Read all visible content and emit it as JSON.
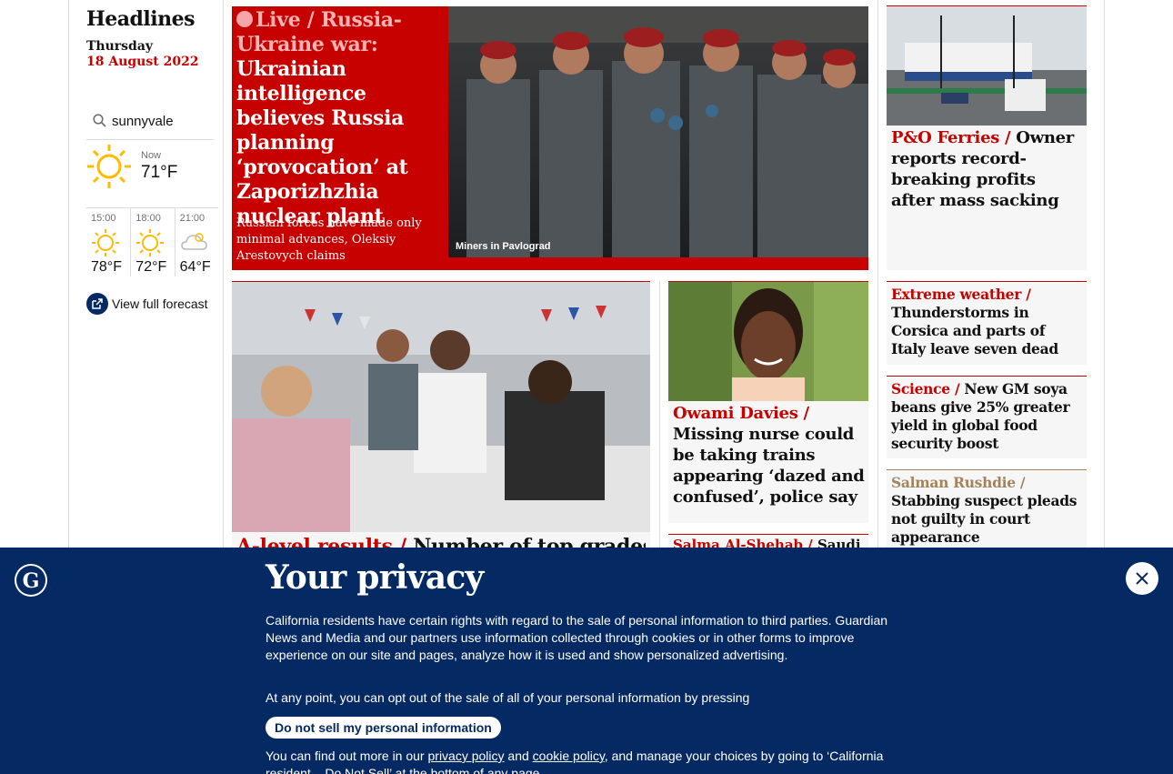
{
  "sidebar": {
    "title": "Headlines",
    "day": "Thursday",
    "date": "18 August 2022",
    "search_value": "sunnyvale",
    "now_label": "Now",
    "now_temp": "71°F",
    "now_icon": "sun-icon",
    "forecast": [
      {
        "time": "15:00",
        "temp": "78°F",
        "icon": "sun-icon"
      },
      {
        "time": "18:00",
        "temp": "72°F",
        "icon": "sun-icon"
      },
      {
        "time": "21:00",
        "temp": "64°F",
        "icon": "cloud-icon"
      }
    ],
    "forecast_link": "View full forecast"
  },
  "hero": {
    "live": "Live",
    "kicker_rest": " / Russia-Ukraine war:",
    "headline": "Ukrainian intelligence believes Russia planning ‘provocation’ at Zaporizhzhia nuclear plant",
    "standfirst": "Russian forces have made only minimal advances, Oleksiy Arestovych claims",
    "caption": "Miners in Pavlograd"
  },
  "right_top": {
    "kicker": "P&O Ferries /",
    "headline": "Owner reports record-breaking profits after mass sacking"
  },
  "small_cards": [
    {
      "kicker": "Extreme weather /",
      "headline": "Thunderstorms in Corsica and parts of Italy leave seven dead",
      "kicker_color": "red"
    },
    {
      "kicker": "Science /",
      "headline": "New GM soya beans give 25% greater yield in global food security boost",
      "kicker_color": "red"
    },
    {
      "kicker": "Salman Rushdie /",
      "headline": "Stabbing suspect pleads not guilty in court appearance",
      "kicker_color": "gold"
    }
  ],
  "alevel": {
    "kicker": "A-level results /",
    "headline": "Number of top grades"
  },
  "owami": {
    "kicker": "Owami Davies /",
    "headline": "Missing nurse could be taking trains appearing ‘dazed and confused’, police say"
  },
  "salma": {
    "kicker": "Salma Al-Shehab /",
    "headline": "Saudi"
  },
  "privacy": {
    "title": "Your privacy",
    "body": "California residents have certain rights with regard to the sale of personal information to third parties. Guardian News and Media and our partners use information collected through cookies or in other forms to improve experience on our site and pages, analyze how it is used and show personalized advertising.",
    "opt_out": "At any point, you can opt out of the sale of all of your personal information by pressing",
    "button": "Do not sell my personal information",
    "more_prefix": "You can find out more in our ",
    "privacy_link": "privacy policy",
    "and": " and ",
    "cookie_link": "cookie policy",
    "more_suffix": ", and manage your choices by going to ‘California resident – Do Not Sell’ at the bottom of any page."
  },
  "colors": {
    "brand_red": "#c70000",
    "brand_blue": "#052962",
    "gold": "#a1845c"
  }
}
